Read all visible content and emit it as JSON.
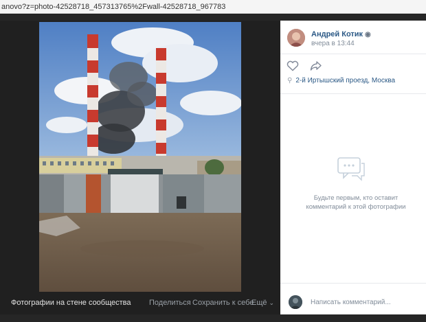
{
  "browser": {
    "url_fragment": "anovo?z=photo-42528718_457313765%2Fwall-42528718_967783"
  },
  "viewer": {
    "album_title": "Фотографии на стене сообщества",
    "actions": {
      "share": "Поделиться",
      "save": "Сохранить к себе",
      "more": "Ещё"
    }
  },
  "post": {
    "author_name": "Андрей Котик",
    "time": "вчера в 13:44",
    "location": "2-й Иртышский проезд, Москва"
  },
  "comments": {
    "empty_message": "Будьте первым, кто оставит комментарий к этой фотографии",
    "input_placeholder": "Написать комментарий..."
  },
  "icons": {
    "verified": "globe-badge-icon",
    "like": "heart-icon",
    "share": "share-arrow-icon",
    "location": "pin-icon",
    "empty_comments": "comments-bubble-icon",
    "more": "chevron-down-icon"
  },
  "colors": {
    "link_blue": "#2a5885",
    "muted_text": "#818c99",
    "viewer_bg": "#202020"
  }
}
